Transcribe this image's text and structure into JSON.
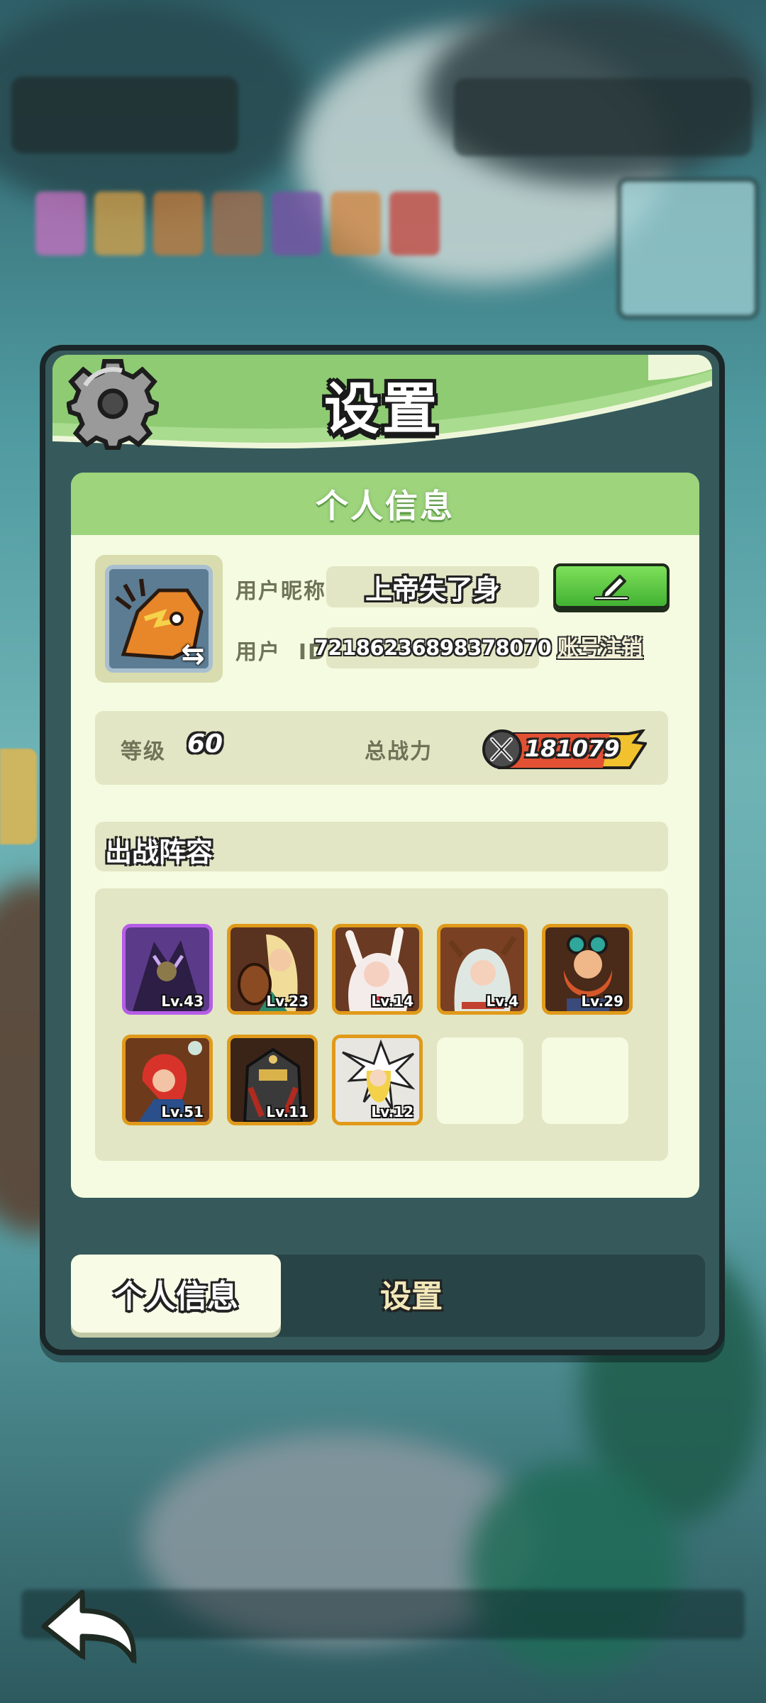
{
  "dialog": {
    "title": "设置",
    "panel_title": "个人信息"
  },
  "profile": {
    "nickname_label": "用户昵称",
    "nickname": "上帝失了身",
    "id_label": "用户  ID",
    "user_id": "72186236898378070",
    "cancel_account_label": "账号注销",
    "edit_icon": "pencil-icon",
    "avatar_icon": "swap-avatar-icon"
  },
  "stats": {
    "level_label": "等级",
    "level": "60",
    "power_label": "总战力",
    "power": "181079"
  },
  "lineup": {
    "title": "出战阵容",
    "heroes": [
      {
        "level": "Lv.43",
        "rarity": "purple"
      },
      {
        "level": "Lv.23",
        "rarity": "orange"
      },
      {
        "level": "Lv.14",
        "rarity": "orange"
      },
      {
        "level": "Lv.4",
        "rarity": "orange"
      },
      {
        "level": "Lv.29",
        "rarity": "orange"
      },
      {
        "level": "Lv.51",
        "rarity": "orange"
      },
      {
        "level": "Lv.11",
        "rarity": "orange"
      },
      {
        "level": "Lv.12",
        "rarity": "orange"
      }
    ],
    "empty_slots": 2
  },
  "tabs": [
    {
      "label": "个人信息",
      "active": true
    },
    {
      "label": "设置",
      "active": false
    }
  ],
  "colors": {
    "header_green": "#9dd47c",
    "panel_bg": "#f4fbe0",
    "frame_bg": "#365a5b",
    "edit_button": "#42b233",
    "hero_border_orange": "#e09a1a",
    "hero_border_purple": "#b65de8"
  },
  "icons": {
    "settings": "gear-icon",
    "back": "back-arrow-icon",
    "power": "crossed-swords-icon"
  }
}
